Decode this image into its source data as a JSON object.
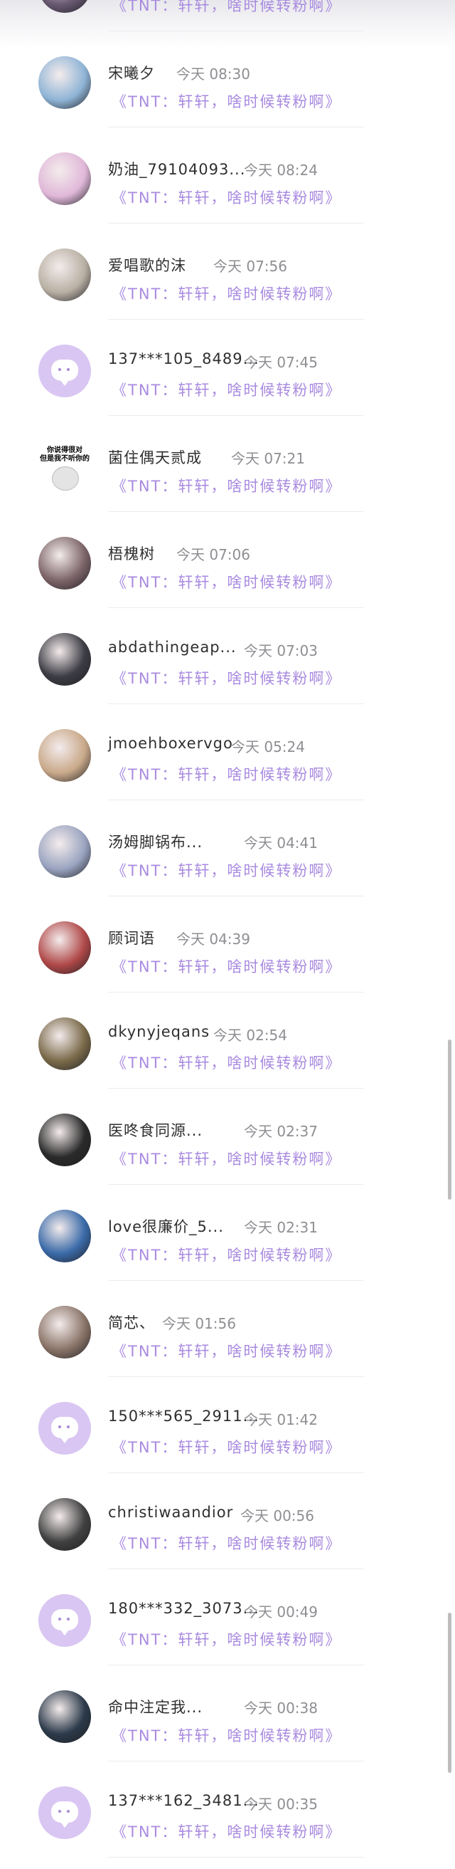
{
  "items": [
    {
      "name": "",
      "time": "",
      "message": "《TNT：轩轩，啥时候转粉啊》",
      "avatar": "photo",
      "avatar_color": "#6a5a72"
    },
    {
      "name": "宋曦夕",
      "time": "今天 08:30",
      "message": "《TNT：轩轩，啥时候转粉啊》",
      "avatar": "photo",
      "avatar_color": "#8fb4d6"
    },
    {
      "name": "奶油_79104093...",
      "time": "今天 08:24",
      "message": "《TNT：轩轩，啥时候转粉啊》",
      "avatar": "photo",
      "avatar_color": "#e0b8d8"
    },
    {
      "name": "爱唱歌的沫",
      "time": "今天 07:56",
      "message": "《TNT：轩轩，啥时候转粉啊》",
      "avatar": "photo",
      "avatar_color": "#b9b0a4"
    },
    {
      "name": "137***105_8489...",
      "time": "今天 07:45",
      "message": "《TNT：轩轩，啥时候转粉啊》",
      "avatar": "default",
      "avatar_color": "#d9c6f2"
    },
    {
      "name": "菌住偶天贰成",
      "time": "今天 07:21",
      "message": "《TNT：轩轩，啥时候转粉啊》",
      "avatar": "meme",
      "avatar_color": "#ffffff",
      "meme_text": "你说得很对\n但是我不听你的"
    },
    {
      "name": "梧槐树",
      "time": "今天 07:06",
      "message": "《TNT：轩轩，啥时候转粉啊》",
      "avatar": "photo",
      "avatar_color": "#7c6468"
    },
    {
      "name": "abdathingeap...",
      "time": "今天 07:03",
      "message": "《TNT：轩轩，啥时候转粉啊》",
      "avatar": "photo",
      "avatar_color": "#3c3c44"
    },
    {
      "name": "jmoehboxervgo",
      "time": "今天 05:24",
      "message": "《TNT：轩轩，啥时候转粉啊》",
      "avatar": "photo",
      "avatar_color": "#c9a98a"
    },
    {
      "name": "汤姆脚锅布...",
      "time": "今天 04:41",
      "message": "《TNT：轩轩，啥时候转粉啊》",
      "avatar": "photo",
      "avatar_color": "#9aa4c0"
    },
    {
      "name": "顾词语",
      "time": "今天 04:39",
      "message": "《TNT：轩轩，啥时候转粉啊》",
      "avatar": "photo",
      "avatar_color": "#b04848"
    },
    {
      "name": "dkynyjeqans",
      "time": "今天 02:54",
      "message": "《TNT：轩轩，啥时候转粉啊》",
      "avatar": "photo",
      "avatar_color": "#7a6a4a"
    },
    {
      "name": "医咚食同源...",
      "time": "今天 02:37",
      "message": "《TNT：轩轩，啥时候转粉啊》",
      "avatar": "photo",
      "avatar_color": "#2a2a2a"
    },
    {
      "name": "love很廉价_5...",
      "time": "今天 02:31",
      "message": "《TNT：轩轩，啥时候转粉啊》",
      "avatar": "photo",
      "avatar_color": "#3a6aa8"
    },
    {
      "name": "简芯、",
      "time": "今天 01:56",
      "message": "《TNT：轩轩，啥时候转粉啊》",
      "avatar": "photo",
      "avatar_color": "#8a7468"
    },
    {
      "name": "150***565_2911...",
      "time": "今天 01:42",
      "message": "《TNT：轩轩，啥时候转粉啊》",
      "avatar": "default",
      "avatar_color": "#d9c6f2"
    },
    {
      "name": "christiwaandior",
      "time": "今天 00:56",
      "message": "《TNT：轩轩，啥时候转粉啊》",
      "avatar": "photo",
      "avatar_color": "#404040"
    },
    {
      "name": "180***332_3073...",
      "time": "今天 00:49",
      "message": "《TNT：轩轩，啥时候转粉啊》",
      "avatar": "default",
      "avatar_color": "#d9c6f2"
    },
    {
      "name": "命中注定我...",
      "time": "今天 00:38",
      "message": "《TNT：轩轩，啥时候转粉啊》",
      "avatar": "photo",
      "avatar_color": "#2c3a4a"
    },
    {
      "name": "137***162_3481...",
      "time": "今天 00:35",
      "message": "《TNT：轩轩，啥时候转粉啊》",
      "avatar": "default",
      "avatar_color": "#d9c6f2"
    }
  ],
  "colors": {
    "message": "#a98be0",
    "name": "#2f2f2f",
    "time": "#8e8e93"
  }
}
